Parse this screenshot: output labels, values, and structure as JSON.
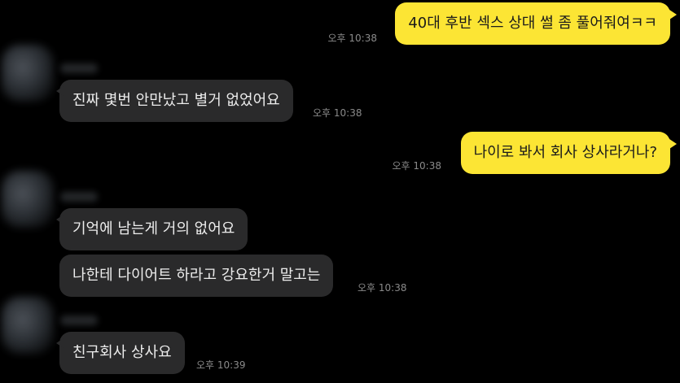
{
  "conversation": {
    "messages": [
      {
        "direction": "outgoing",
        "text": "40대 후반 섹스 상대 썰 좀 풀어줘여ㅋㅋ",
        "time": "오후 10:38"
      },
      {
        "direction": "incoming",
        "text": "진짜 몇번 안만났고 별거 없었어요",
        "time": "오후 10:38"
      },
      {
        "direction": "outgoing",
        "text": "나이로 봐서 회사 상사라거나?",
        "time": "오후 10:38"
      },
      {
        "direction": "incoming",
        "text": "기억에 남는게 거의 없어요",
        "time": ""
      },
      {
        "direction": "incoming",
        "text": "나한테 다이어트 하라고 강요한거 말고는",
        "time": "오후 10:38"
      },
      {
        "direction": "incoming",
        "text": "친구회사 상사요",
        "time": "오후 10:39"
      }
    ]
  },
  "colors": {
    "background": "#000000",
    "incoming_bubble": "#2a2a2b",
    "outgoing_bubble": "#fce534",
    "timestamp": "#8a8a8a"
  }
}
